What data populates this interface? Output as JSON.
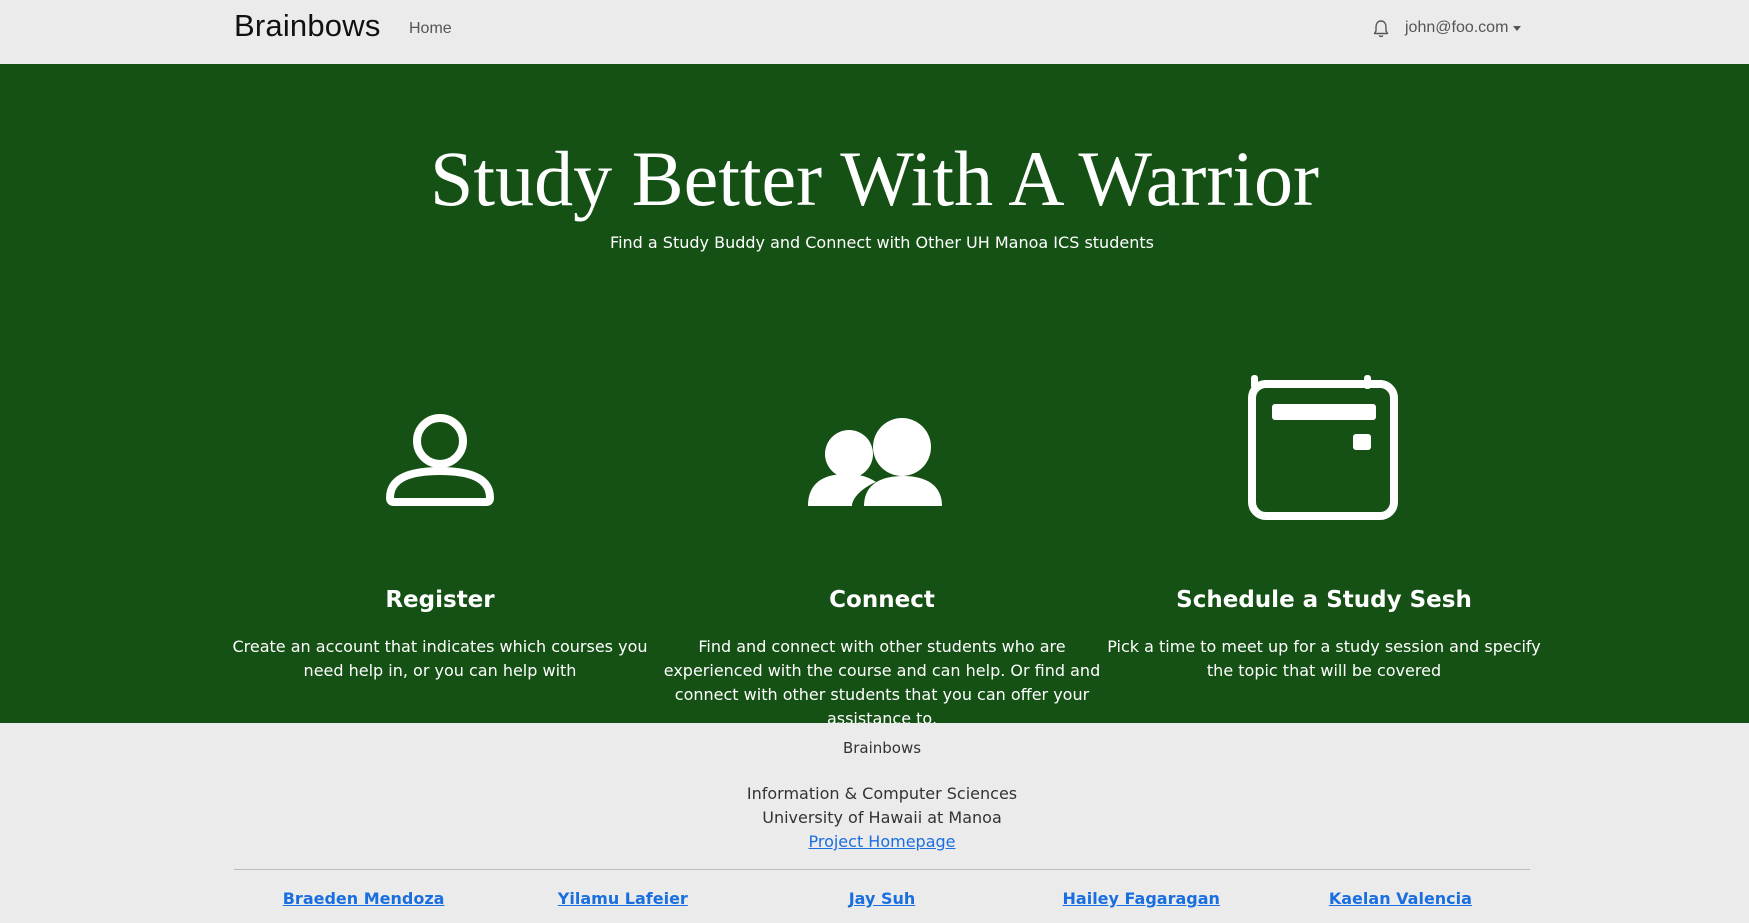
{
  "navbar": {
    "brand": "Brainbows",
    "home_label": "Home",
    "user_email": "john@foo.com"
  },
  "hero": {
    "title": "Study Better With A Warrior",
    "subtitle": "Find a Study Buddy and Connect with Other UH Manoa ICS students",
    "background_color": "#155115"
  },
  "features": [
    {
      "icon": "person-icon",
      "title": "Register",
      "description": "Create an account that indicates which courses you need help in, or you can help with"
    },
    {
      "icon": "people-icon",
      "title": "Connect",
      "description": "Find and connect with other students who are experienced with the course and can help. Or find and connect with other students that you can offer your assistance to."
    },
    {
      "icon": "calendar-icon",
      "title": "Schedule a Study Sesh",
      "description": "Pick a time to meet up for a study session and specify the topic that will be covered"
    }
  ],
  "footer": {
    "brand": "Brainbows",
    "line1": "Information & Computer Sciences",
    "line2": "University of Hawaii at Manoa",
    "homepage_link": "Project Homepage",
    "team": [
      "Braeden Mendoza",
      "Yilamu Lafeier",
      "Jay Suh",
      "Hailey Fagaragan",
      "Kaelan Valencia"
    ]
  }
}
